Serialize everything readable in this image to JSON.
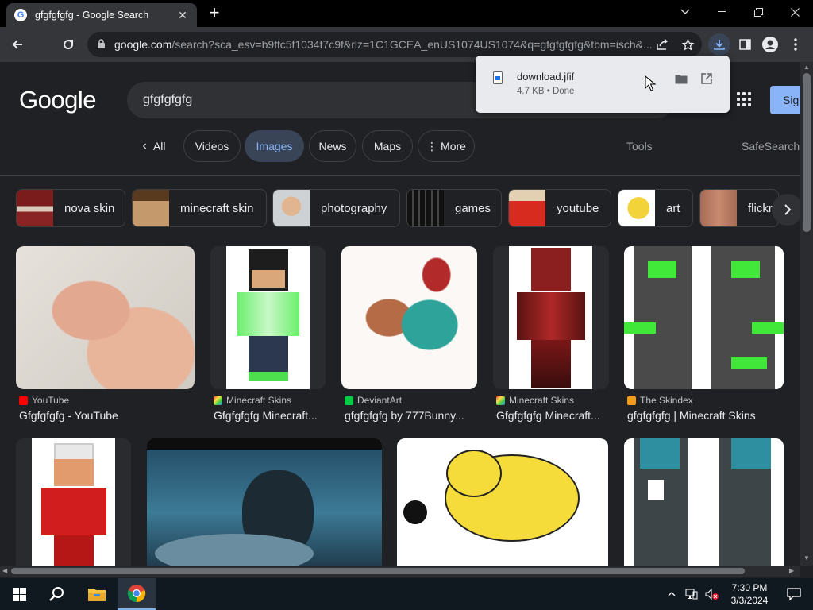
{
  "browser": {
    "tab_title": "gfgfgfgfg - Google Search",
    "favicon_letter": "G",
    "url_host": "google.com",
    "url_rest": "/search?sca_esv=b9ffc5f1034f7c9f&rlz=1C1GCEA_enUS1074US1074&q=gfgfgfgfg&tbm=isch&..."
  },
  "google": {
    "logo": "Google",
    "query": "gfgfgfgfg",
    "signin_label": "Sig"
  },
  "filters": {
    "all": "All",
    "videos": "Videos",
    "images": "Images",
    "news": "News",
    "maps": "Maps",
    "more": "More",
    "tools": "Tools",
    "safesearch": "SafeSearch"
  },
  "related": [
    {
      "label": "nova skin"
    },
    {
      "label": "minecraft skin"
    },
    {
      "label": "photography"
    },
    {
      "label": "games"
    },
    {
      "label": "youtube"
    },
    {
      "label": "art"
    },
    {
      "label": "flickr"
    }
  ],
  "results": [
    {
      "source": "YouTube",
      "title": "Gfgfgfgfg - YouTube"
    },
    {
      "source": "Minecraft Skins",
      "title": "Gfgfgfgfg Minecraft..."
    },
    {
      "source": "DeviantArt",
      "title": "gfgfgfgfg by 777Bunny..."
    },
    {
      "source": "Minecraft Skins",
      "title": "Gfgfgfgfg Minecraft..."
    },
    {
      "source": "The Skindex",
      "title": "gfgfgfgfg | Minecraft Skins"
    }
  ],
  "download": {
    "filename": "download.jfif",
    "meta": "4.7 KB • Done"
  },
  "taskbar": {
    "time": "7:30 PM",
    "date": "3/3/2024"
  },
  "colors": {
    "accent": "#8ab4f8",
    "page_bg": "#202124",
    "active_chip": "#394457"
  }
}
